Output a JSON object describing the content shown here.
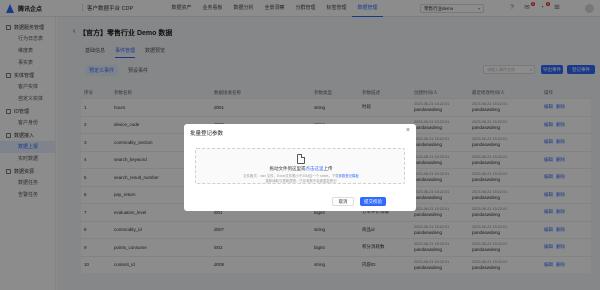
{
  "app": {
    "logo_text": "腾讯企点",
    "product": "客户数据平台 CDP"
  },
  "topnav": [
    "数据资产",
    "业务看板",
    "数据分析",
    "全景洞察",
    "分群管理",
    "标签管理",
    "数据管理"
  ],
  "project": "零售行业demo",
  "notification_badges": {
    "bell": "8",
    "msg": "8"
  },
  "sidebar": [
    {
      "group": "数据服务管理",
      "items": [
        "行为日志表",
        "维度表",
        "事实表"
      ]
    },
    {
      "group": "实体管理",
      "items": [
        "客户实体",
        "自定义实体"
      ]
    },
    {
      "group": "ID管理",
      "items": [
        "客户身份"
      ]
    },
    {
      "group": "数据接入",
      "items": [
        "数据上报",
        "实时数据"
      ]
    },
    {
      "group": "数据资源",
      "items": [
        "数据任务",
        "告警任务"
      ]
    }
  ],
  "page": {
    "title": "【官方】零售行业 Demo 数据",
    "tabs": [
      "基础信息",
      "事件管理",
      "数据预览"
    ],
    "subtabs": [
      "预定义事件",
      "预设事件"
    ],
    "search_placeholder": "请输入事件名称",
    "import_label": "导出事件",
    "register_label": "登记事件"
  },
  "table": {
    "headers": [
      "序号",
      "参数名称",
      "数据接收名称",
      "参数类型",
      "参数描述",
      "创建时间/人",
      "最近修改时间/人",
      "操作"
    ],
    "rows": [
      [
        "1",
        "hours",
        "d001",
        "string",
        "时段",
        "2023-06-21 15:22:01",
        "2023-06-21 15:22:01"
      ],
      [
        "2",
        "device_code",
        "d002",
        "string",
        "",
        "2023-06-21 15:22:01",
        "2023-06-21 15:22:01"
      ],
      [
        "3",
        "commodity_section",
        "d003",
        "string",
        "",
        "2023-06-21 15:22:01",
        "2023-06-21 15:22:01"
      ],
      [
        "4",
        "search_keyword",
        "d004",
        "string",
        "",
        "2023-06-21 15:22:01",
        "2023-06-21 15:22:01"
      ],
      [
        "5",
        "search_result_number",
        "d005",
        "string",
        "",
        "2023-06-21 15:22:01",
        "2023-06-21 15:22:01"
      ],
      [
        "6",
        "pay_return",
        "d006",
        "string",
        "",
        "2023-06-21 15:22:01",
        "2023-06-21 15:22:01"
      ],
      [
        "7",
        "evaluation_level",
        "i001",
        "bigint",
        "订单评价等级",
        "2023-06-21 15:22:01",
        "2023-06-21 15:22:01"
      ],
      [
        "8",
        "commodity_id",
        "d007",
        "string",
        "商品id",
        "2023-06-21 15:22:01",
        "2023-06-21 15:22:01"
      ],
      [
        "9",
        "points_consume",
        "i002",
        "bigint",
        "积分消耗数",
        "2023-06-21 15:22:01",
        "2023-06-21 15:22:01"
      ],
      [
        "10",
        "content_id",
        "d008",
        "string",
        "内容ID",
        "2023-06-21 15:22:01",
        "2023-06-21 15:22:01"
      ]
    ],
    "creator": "pandaswdeng",
    "action_edit": "编辑",
    "action_delete": "删除"
  },
  "modal": {
    "title": "批量登记参数",
    "drop_main_prefix": "拖动文件到这里或",
    "drop_main_link": "点击这里",
    "drop_main_suffix": "上传",
    "hint1_prefix": "文件格式：xlsx 文件，Excel文件需小于20M且一个 sheet。下载",
    "hint1_link": "参数登记模板",
    "hint2": "重新读取与更新逻辑，已存参数不会被重复登记",
    "cancel_label": "取消",
    "submit_label": "提交校验"
  }
}
